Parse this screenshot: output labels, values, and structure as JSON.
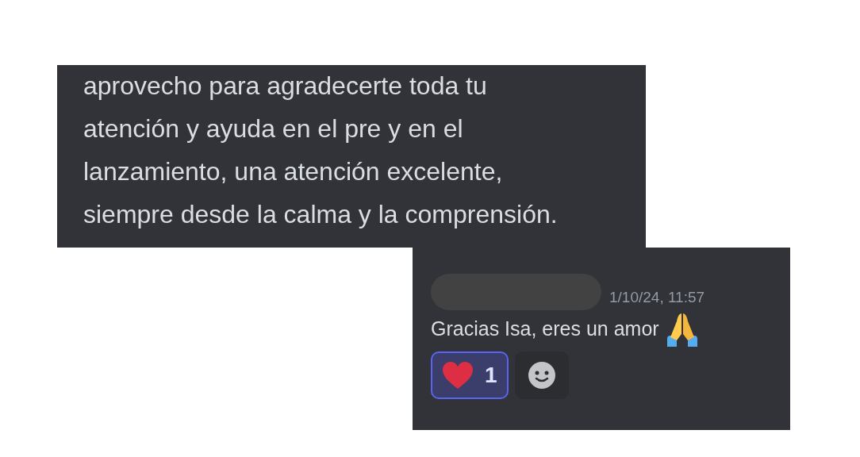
{
  "quoted_message": {
    "text": "aprovecho para agradecerte toda tu atención y ayuda en el pre y en el lanzamiento, una atención excelente, siempre desde la calma y la comprensión."
  },
  "reply": {
    "timestamp": "1/10/24, 11:57",
    "text": "Gracias Isa, eres un amor",
    "reactions": [
      {
        "kind": "heart",
        "count": "1",
        "selected": true
      }
    ]
  }
}
